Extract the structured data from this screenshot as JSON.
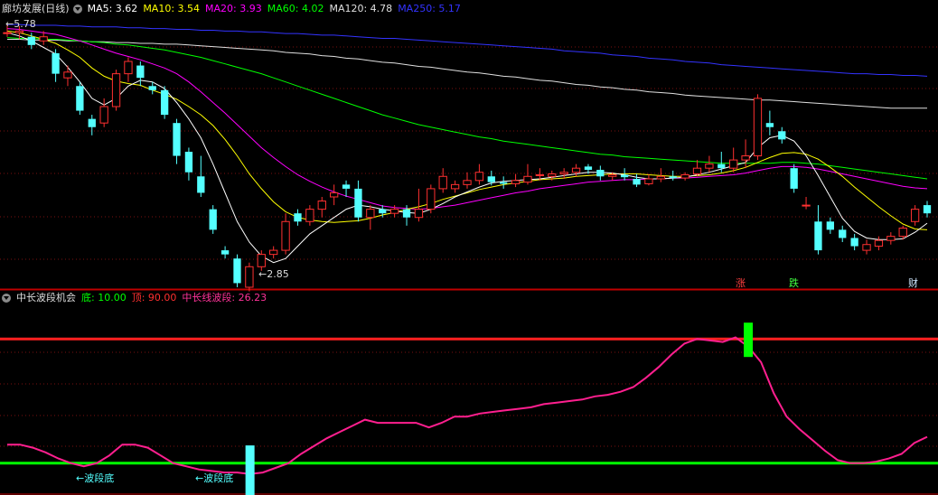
{
  "main_panel": {
    "title": "廊坊发展(日线)",
    "indicators": [
      {
        "label": "MA5: 3.62",
        "color": "#ffffff"
      },
      {
        "label": "MA10: 3.54",
        "color": "#ffff00"
      },
      {
        "label": "MA20: 3.93",
        "color": "#ff00ff"
      },
      {
        "label": "MA60: 4.02",
        "color": "#00ff00"
      },
      {
        "label": "MA120: 4.78",
        "color": "#e0e0e0"
      },
      {
        "label": "MA250: 5.17",
        "color": "#3333ff"
      }
    ],
    "high_label": "5.78",
    "low_label": "2.85",
    "markers": {
      "zhang": "涨",
      "die": "跌",
      "cai": "财"
    }
  },
  "sub_panel": {
    "title": "中长波段机会",
    "indicators": [
      {
        "label": "底: 10.00",
        "color": "#00ff00"
      },
      {
        "label": "顶: 90.00",
        "color": "#ff3030"
      },
      {
        "label": "中长线波段: 26.23",
        "color": "#ff3399"
      }
    ],
    "annotations": [
      "←波段底",
      "←波段底"
    ],
    "bottom_level": 10,
    "top_level": 90
  },
  "colors": {
    "up": "#ff3030",
    "down": "#54ffff",
    "grid": "#7a1010",
    "border": "#c00000"
  },
  "chart_data": {
    "type": "candlestick",
    "y_range": [
      2.6,
      5.9
    ],
    "candles": [
      [
        5.7,
        5.7,
        5.8,
        5.65
      ],
      [
        5.7,
        5.72,
        5.78,
        5.62
      ],
      [
        5.65,
        5.55,
        5.7,
        5.5
      ],
      [
        5.6,
        5.65,
        5.72,
        5.55
      ],
      [
        5.45,
        5.2,
        5.5,
        5.1
      ],
      [
        5.15,
        5.22,
        5.3,
        5.05
      ],
      [
        5.05,
        4.75,
        5.1,
        4.7
      ],
      [
        4.65,
        4.55,
        4.7,
        4.45
      ],
      [
        4.6,
        4.8,
        4.9,
        4.55
      ],
      [
        4.8,
        5.2,
        5.25,
        4.75
      ],
      [
        5.2,
        5.35,
        5.4,
        5.1
      ],
      [
        5.3,
        5.15,
        5.35,
        5.05
      ],
      [
        5.05,
        5.0,
        5.1,
        4.95
      ],
      [
        5.0,
        4.7,
        5.05,
        4.65
      ],
      [
        4.6,
        4.2,
        4.65,
        4.1
      ],
      [
        4.25,
        4.0,
        4.3,
        3.9
      ],
      [
        3.95,
        3.75,
        4.2,
        3.7
      ],
      [
        3.55,
        3.3,
        3.6,
        3.25
      ],
      [
        3.05,
        3.0,
        3.1,
        2.95
      ],
      [
        2.95,
        2.65,
        3.0,
        2.6
      ],
      [
        2.6,
        2.85,
        2.9,
        2.55
      ],
      [
        2.85,
        3.0,
        3.05,
        2.8
      ],
      [
        3.0,
        3.05,
        3.1,
        2.95
      ],
      [
        3.05,
        3.4,
        3.5,
        3.0
      ],
      [
        3.5,
        3.4,
        3.55,
        3.35
      ],
      [
        3.4,
        3.55,
        3.6,
        3.35
      ],
      [
        3.55,
        3.65,
        3.7,
        3.45
      ],
      [
        3.7,
        3.75,
        3.85,
        3.6
      ],
      [
        3.85,
        3.8,
        3.9,
        3.7
      ],
      [
        3.8,
        3.45,
        3.9,
        3.4
      ],
      [
        3.45,
        3.55,
        3.6,
        3.3
      ],
      [
        3.55,
        3.5,
        3.6,
        3.45
      ],
      [
        3.5,
        3.55,
        3.6,
        3.45
      ],
      [
        3.55,
        3.45,
        3.6,
        3.35
      ],
      [
        3.45,
        3.55,
        3.8,
        3.4
      ],
      [
        3.55,
        3.8,
        3.85,
        3.5
      ],
      [
        3.8,
        3.95,
        4.05,
        3.75
      ],
      [
        3.8,
        3.85,
        3.9,
        3.75
      ],
      [
        3.85,
        3.9,
        4.0,
        3.8
      ],
      [
        3.9,
        4.0,
        4.1,
        3.85
      ],
      [
        3.95,
        3.88,
        4.02,
        3.84
      ],
      [
        3.88,
        3.86,
        3.95,
        3.8
      ],
      [
        3.86,
        3.9,
        3.98,
        3.82
      ],
      [
        3.88,
        3.95,
        4.1,
        3.85
      ],
      [
        3.96,
        3.97,
        4.05,
        3.9
      ],
      [
        3.95,
        3.98,
        4.02,
        3.9
      ],
      [
        3.98,
        4.0,
        4.05,
        3.92
      ],
      [
        4.0,
        4.05,
        4.1,
        3.95
      ],
      [
        4.07,
        4.03,
        4.1,
        3.98
      ],
      [
        4.03,
        3.95,
        4.08,
        3.9
      ],
      [
        3.95,
        3.97,
        4.0,
        3.9
      ],
      [
        3.97,
        3.94,
        4.05,
        3.9
      ],
      [
        3.92,
        3.85,
        3.98,
        3.82
      ],
      [
        3.86,
        3.92,
        3.98,
        3.84
      ],
      [
        3.92,
        3.95,
        4.05,
        3.88
      ],
      [
        3.95,
        3.93,
        4.02,
        3.9
      ],
      [
        3.93,
        3.97,
        4.0,
        3.9
      ],
      [
        3.98,
        4.05,
        4.15,
        3.95
      ],
      [
        4.05,
        4.1,
        4.2,
        4.0
      ],
      [
        4.1,
        4.05,
        4.25,
        4.0
      ],
      [
        4.05,
        4.15,
        4.3,
        4.0
      ],
      [
        4.15,
        4.2,
        4.4,
        4.05
      ],
      [
        4.2,
        4.9,
        4.95,
        4.15
      ],
      [
        4.6,
        4.55,
        4.75,
        4.45
      ],
      [
        4.5,
        4.4,
        4.55,
        4.35
      ],
      [
        4.05,
        3.8,
        4.1,
        3.75
      ],
      [
        3.6,
        3.6,
        3.7,
        3.55
      ],
      [
        3.4,
        3.05,
        3.6,
        3.0
      ],
      [
        3.4,
        3.3,
        3.45,
        3.25
      ],
      [
        3.3,
        3.2,
        3.35,
        3.15
      ],
      [
        3.2,
        3.1,
        3.25,
        3.05
      ],
      [
        3.05,
        3.12,
        3.18,
        3.0
      ],
      [
        3.1,
        3.17,
        3.22,
        3.05
      ],
      [
        3.17,
        3.22,
        3.27,
        3.12
      ],
      [
        3.22,
        3.32,
        3.35,
        3.18
      ],
      [
        3.4,
        3.55,
        3.6,
        3.35
      ],
      [
        3.6,
        3.5,
        3.65,
        3.45
      ]
    ],
    "ma": {
      "MA5": [
        5.7,
        5.66,
        5.6,
        5.52,
        5.44,
        5.28,
        5.1,
        4.9,
        4.82,
        4.9,
        5.05,
        5.12,
        5.1,
        5.02,
        4.85,
        4.65,
        4.42,
        4.1,
        3.75,
        3.4,
        3.15,
        2.98,
        2.9,
        2.95,
        3.1,
        3.25,
        3.35,
        3.45,
        3.55,
        3.6,
        3.58,
        3.55,
        3.53,
        3.51,
        3.5,
        3.55,
        3.62,
        3.7,
        3.76,
        3.82,
        3.87,
        3.89,
        3.9,
        3.91,
        3.92,
        3.94,
        3.96,
        3.98,
        4.0,
        4.0,
        3.99,
        3.97,
        3.94,
        3.92,
        3.92,
        3.93,
        3.94,
        3.97,
        4.0,
        4.04,
        4.08,
        4.12,
        4.3,
        4.42,
        4.45,
        4.38,
        4.2,
        3.96,
        3.7,
        3.44,
        3.28,
        3.2,
        3.18,
        3.18,
        3.19,
        3.27,
        3.38
      ],
      "MA10": [
        5.72,
        5.7,
        5.66,
        5.62,
        5.57,
        5.49,
        5.4,
        5.27,
        5.17,
        5.11,
        5.08,
        5.06,
        5.0,
        4.95,
        4.89,
        4.8,
        4.7,
        4.57,
        4.4,
        4.2,
        3.98,
        3.8,
        3.64,
        3.52,
        3.45,
        3.42,
        3.4,
        3.39,
        3.4,
        3.41,
        3.44,
        3.48,
        3.51,
        3.55,
        3.58,
        3.62,
        3.67,
        3.71,
        3.75,
        3.79,
        3.82,
        3.85,
        3.87,
        3.89,
        3.91,
        3.92,
        3.93,
        3.95,
        3.96,
        3.97,
        3.98,
        3.98,
        3.98,
        3.97,
        3.96,
        3.95,
        3.95,
        3.96,
        3.97,
        3.99,
        4.02,
        4.06,
        4.12,
        4.18,
        4.23,
        4.24,
        4.22,
        4.16,
        4.06,
        3.95,
        3.82,
        3.7,
        3.58,
        3.47,
        3.37,
        3.31,
        3.3
      ],
      "MA20": [
        5.75,
        5.74,
        5.72,
        5.7,
        5.68,
        5.64,
        5.6,
        5.55,
        5.5,
        5.45,
        5.41,
        5.37,
        5.32,
        5.27,
        5.2,
        5.1,
        4.98,
        4.85,
        4.72,
        4.58,
        4.44,
        4.3,
        4.18,
        4.07,
        3.97,
        3.89,
        3.82,
        3.76,
        3.71,
        3.67,
        3.63,
        3.59,
        3.57,
        3.56,
        3.55,
        3.56,
        3.58,
        3.6,
        3.63,
        3.66,
        3.69,
        3.72,
        3.75,
        3.77,
        3.8,
        3.82,
        3.84,
        3.86,
        3.88,
        3.89,
        3.9,
        3.91,
        3.91,
        3.92,
        3.92,
        3.93,
        3.93,
        3.94,
        3.95,
        3.96,
        3.97,
        3.99,
        4.02,
        4.05,
        4.07,
        4.07,
        4.06,
        4.04,
        4.01,
        3.98,
        3.95,
        3.92,
        3.89,
        3.86,
        3.83,
        3.81,
        3.8
      ],
      "MA60": [
        5.64,
        5.63,
        5.63,
        5.62,
        5.62,
        5.61,
        5.6,
        5.59,
        5.58,
        5.56,
        5.55,
        5.53,
        5.51,
        5.49,
        5.46,
        5.43,
        5.4,
        5.36,
        5.32,
        5.28,
        5.24,
        5.2,
        5.15,
        5.1,
        5.05,
        5.0,
        4.95,
        4.9,
        4.85,
        4.8,
        4.75,
        4.7,
        4.66,
        4.62,
        4.58,
        4.55,
        4.52,
        4.49,
        4.46,
        4.43,
        4.41,
        4.38,
        4.36,
        4.34,
        4.32,
        4.3,
        4.28,
        4.26,
        4.24,
        4.22,
        4.21,
        4.19,
        4.18,
        4.17,
        4.16,
        4.15,
        4.14,
        4.13,
        4.12,
        4.11,
        4.11,
        4.11,
        4.11,
        4.11,
        4.12,
        4.12,
        4.11,
        4.1,
        4.08,
        4.06,
        4.04,
        4.02,
        4.0,
        3.98,
        3.96,
        3.94,
        3.92
      ],
      "MA120": [
        5.62,
        5.62,
        5.61,
        5.61,
        5.61,
        5.6,
        5.6,
        5.59,
        5.59,
        5.58,
        5.58,
        5.57,
        5.57,
        5.56,
        5.56,
        5.55,
        5.54,
        5.53,
        5.52,
        5.51,
        5.5,
        5.49,
        5.48,
        5.46,
        5.45,
        5.44,
        5.42,
        5.41,
        5.39,
        5.38,
        5.36,
        5.34,
        5.33,
        5.31,
        5.29,
        5.28,
        5.26,
        5.24,
        5.22,
        5.21,
        5.19,
        5.17,
        5.16,
        5.14,
        5.12,
        5.11,
        5.09,
        5.07,
        5.06,
        5.04,
        5.03,
        5.01,
        5.0,
        4.98,
        4.97,
        4.96,
        4.94,
        4.93,
        4.92,
        4.91,
        4.9,
        4.89,
        4.88,
        4.88,
        4.87,
        4.86,
        4.85,
        4.84,
        4.83,
        4.82,
        4.81,
        4.8,
        4.79,
        4.78,
        4.78,
        4.78,
        4.78
      ],
      "MA250": [
        5.8,
        5.8,
        5.79,
        5.79,
        5.79,
        5.78,
        5.78,
        5.77,
        5.77,
        5.77,
        5.76,
        5.76,
        5.75,
        5.75,
        5.74,
        5.74,
        5.73,
        5.73,
        5.72,
        5.72,
        5.71,
        5.71,
        5.7,
        5.69,
        5.69,
        5.68,
        5.67,
        5.67,
        5.66,
        5.65,
        5.64,
        5.63,
        5.63,
        5.62,
        5.61,
        5.6,
        5.59,
        5.58,
        5.57,
        5.56,
        5.55,
        5.54,
        5.53,
        5.52,
        5.51,
        5.5,
        5.48,
        5.47,
        5.46,
        5.45,
        5.43,
        5.42,
        5.41,
        5.39,
        5.38,
        5.37,
        5.35,
        5.34,
        5.33,
        5.31,
        5.3,
        5.29,
        5.28,
        5.27,
        5.26,
        5.25,
        5.24,
        5.23,
        5.22,
        5.21,
        5.2,
        5.2,
        5.19,
        5.19,
        5.18,
        5.18,
        5.17
      ]
    },
    "wave": [
      22,
      22,
      20,
      17,
      13,
      10,
      8,
      10,
      15,
      22,
      22,
      20,
      15,
      10,
      8,
      6,
      5,
      4,
      4,
      3,
      4,
      7,
      10,
      16,
      21,
      26,
      30,
      34,
      38,
      36,
      36,
      36,
      36,
      33,
      36,
      40,
      40,
      42,
      43,
      44,
      45,
      46,
      48,
      49,
      50,
      51,
      53,
      54,
      56,
      59,
      65,
      72,
      80,
      87,
      90,
      89,
      88,
      91,
      85,
      75,
      55,
      40,
      32,
      25,
      18,
      12,
      10,
      10,
      11,
      13,
      16,
      23,
      27
    ],
    "sub_y_range": [
      0,
      100
    ]
  }
}
